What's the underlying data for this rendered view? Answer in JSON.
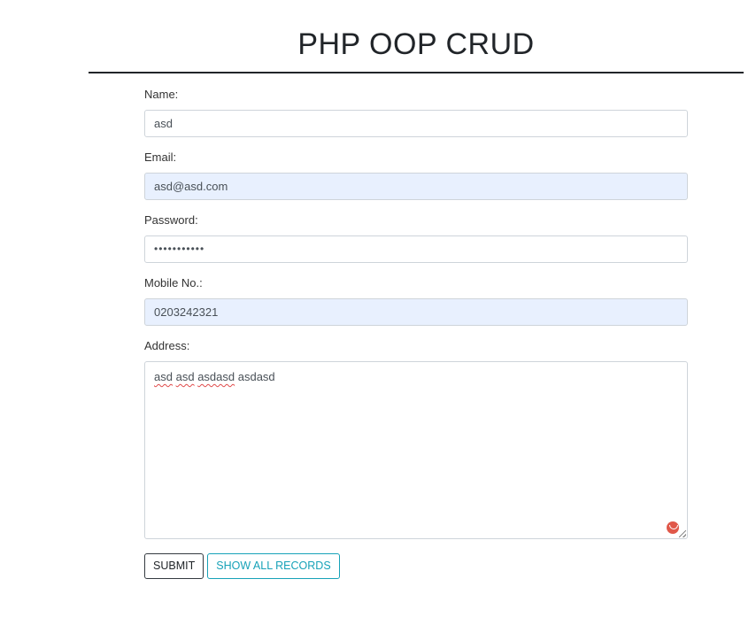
{
  "header": {
    "title": "PHP OOP CRUD"
  },
  "form": {
    "name": {
      "label": "Name:",
      "value": "asd"
    },
    "email": {
      "label": "Email:",
      "value": "asd@asd.com"
    },
    "password": {
      "label": "Password:",
      "value": "•••••••••••"
    },
    "mobile": {
      "label": "Mobile No.:",
      "value": "0203242321"
    },
    "address": {
      "label": "Address:",
      "words": [
        "asd",
        "asd",
        "asdasd",
        "asdasd"
      ]
    }
  },
  "buttons": {
    "submit_label": "SUBMIT",
    "show_all_label": "SHOW ALL RECORDS"
  },
  "colors": {
    "autofill_bg": "#e8f0fe",
    "records_accent": "#17a2b8",
    "spellcheck_underline": "#e04b4b",
    "grammarly_badge": "#e0584a"
  },
  "icons": {
    "grammarly": "grammarly-icon",
    "resize": "resize-handle-icon"
  }
}
